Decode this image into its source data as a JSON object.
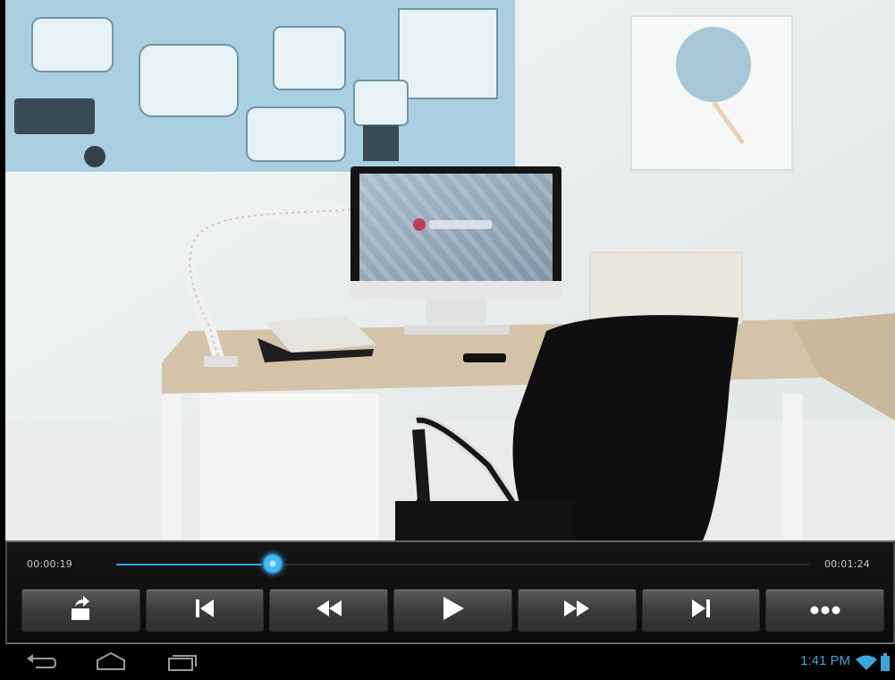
{
  "player": {
    "current_time": "00:00:19",
    "total_time": "00:01:24",
    "progress_fraction": 0.226,
    "accent_color": "#2aa6e0",
    "buttons": [
      {
        "name": "share-button",
        "icon": "share-upload-icon"
      },
      {
        "name": "previous-button",
        "icon": "skip-previous-icon"
      },
      {
        "name": "rewind-button",
        "icon": "rewind-icon"
      },
      {
        "name": "play-button",
        "icon": "play-icon"
      },
      {
        "name": "fast-forward-button",
        "icon": "fast-forward-icon"
      },
      {
        "name": "next-button",
        "icon": "skip-next-icon"
      },
      {
        "name": "more-button",
        "icon": "more-dots-icon"
      }
    ]
  },
  "system_bar": {
    "clock": "1:41 PM",
    "icons": [
      "back-icon",
      "home-icon",
      "recent-apps-icon",
      "wifi-icon",
      "battery-icon"
    ]
  }
}
